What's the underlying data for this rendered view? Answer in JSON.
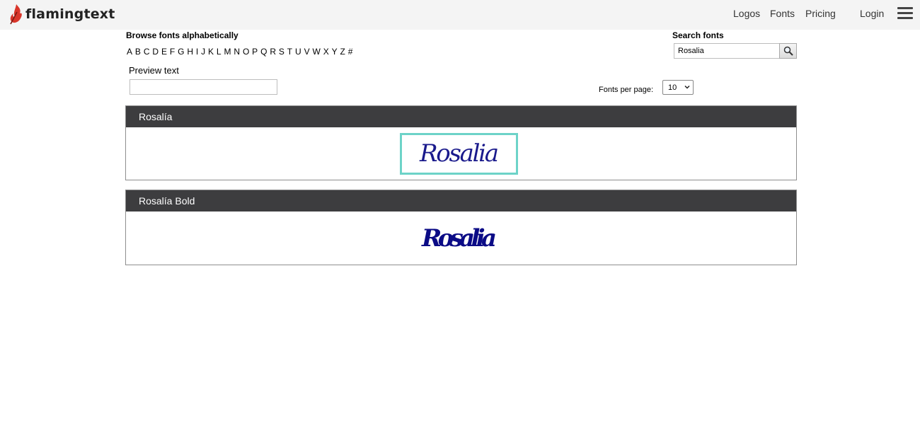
{
  "header": {
    "logo_text": "flamingtext",
    "nav": {
      "logos": "Logos",
      "fonts": "Fonts",
      "pricing": "Pricing",
      "login": "Login"
    }
  },
  "browse": {
    "title": "Browse fonts alphabetically",
    "letters": [
      "A",
      "B",
      "C",
      "D",
      "E",
      "F",
      "G",
      "H",
      "I",
      "J",
      "K",
      "L",
      "M",
      "N",
      "O",
      "P",
      "Q",
      "R",
      "S",
      "T",
      "U",
      "V",
      "W",
      "X",
      "Y",
      "Z",
      "#"
    ]
  },
  "search": {
    "title": "Search fonts",
    "value": "Rosalia"
  },
  "preview": {
    "label": "Preview text",
    "value": ""
  },
  "fonts_per_page": {
    "label": "Fonts per page:",
    "selected": "10"
  },
  "results": [
    {
      "name": "Rosalía",
      "sample_text": "Rosalia",
      "sample_color": "#1a1a8c",
      "selected": true
    },
    {
      "name": "Rosalía Bold",
      "sample_text": "Rosalia",
      "sample_color": "#0b0b86",
      "selected": false
    }
  ],
  "colors": {
    "topbar_bg": "#f4f4f4",
    "card_header_bg": "#3d3d3f",
    "selection_border": "#6dd3c8",
    "logo_flame": "#d9352a"
  }
}
